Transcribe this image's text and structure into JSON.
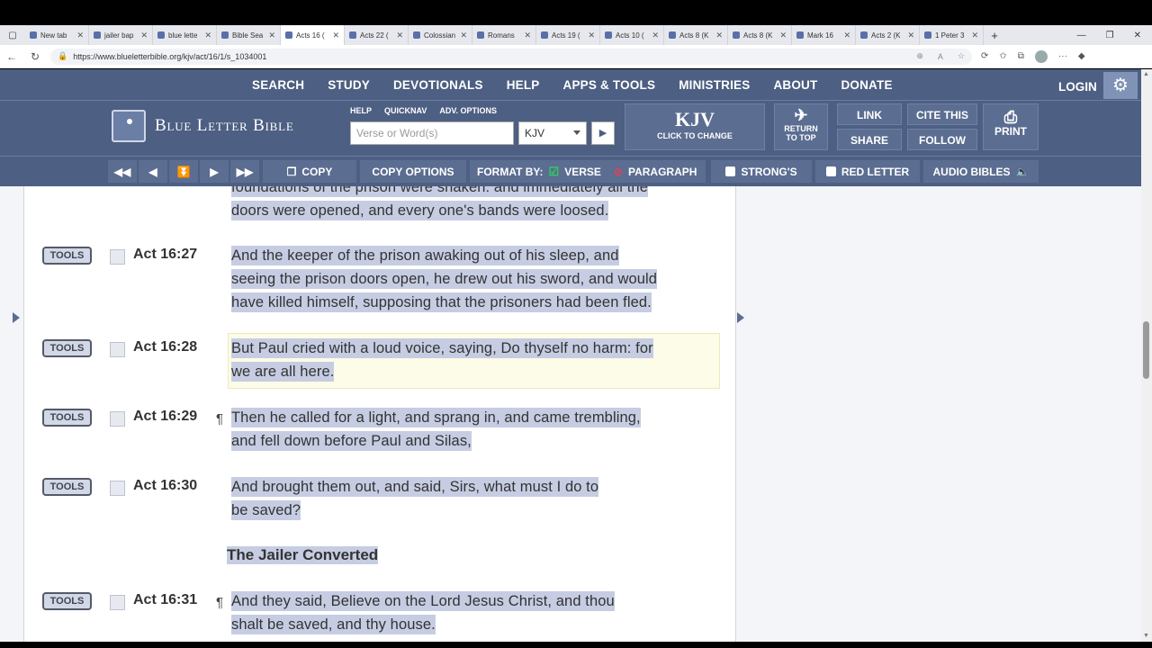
{
  "browser": {
    "tabs": [
      {
        "title": "New tab",
        "active": false
      },
      {
        "title": "jailer bap",
        "active": false
      },
      {
        "title": "blue lette",
        "active": false
      },
      {
        "title": "Bible Sea",
        "active": false
      },
      {
        "title": "Acts 16 (",
        "active": true
      },
      {
        "title": "Acts 22 (",
        "active": false
      },
      {
        "title": "Colossian",
        "active": false
      },
      {
        "title": "Romans",
        "active": false
      },
      {
        "title": "Acts 19 (",
        "active": false
      },
      {
        "title": "Acts 10 (",
        "active": false
      },
      {
        "title": "Acts 8 (K",
        "active": false
      },
      {
        "title": "Acts 8 (K",
        "active": false
      },
      {
        "title": "Mark 16",
        "active": false
      },
      {
        "title": "Acts 2 (K",
        "active": false
      },
      {
        "title": "1 Peter 3",
        "active": false
      }
    ],
    "url": "https://www.blueletterbible.org/kjv/act/16/1/s_1034001"
  },
  "nav": {
    "items": [
      "SEARCH",
      "STUDY",
      "DEVOTIONALS",
      "HELP",
      "APPS & TOOLS",
      "MINISTRIES",
      "ABOUT",
      "DONATE"
    ],
    "login": "LOGIN"
  },
  "header": {
    "logo_text": "Blue Letter Bible",
    "mini_links": [
      "HELP",
      "QUICKNAV",
      "ADV. OPTIONS"
    ],
    "search_placeholder": "Verse or Word(s)",
    "version": "KJV",
    "kjv_big": "KJV",
    "kjv_change": "CLICK TO CHANGE",
    "return_top_1": "RETURN",
    "return_top_2": "TO TOP",
    "link": "LINK",
    "cite": "CITE THIS",
    "share": "SHARE",
    "follow": "FOLLOW",
    "print": "PRINT"
  },
  "toolbar": {
    "copy": "COPY",
    "copy_options": "COPY OPTIONS",
    "format_by": "FORMAT BY:",
    "verse": "VERSE",
    "paragraph": "PARAGRAPH",
    "strongs": "STRONG'S",
    "red_letter": "RED LETTER",
    "audio": "AUDIO BIBLES"
  },
  "verses": {
    "partial_line1": "foundations of the prison were shaken: and immediately all the",
    "partial_line2": "doors were opened, and every one's bands were loosed.",
    "tools_label": "TOOLS",
    "v27_ref": "Act 16:27",
    "v27_l1": "And the keeper of the prison awaking out of his sleep, and",
    "v27_l2": "seeing the prison doors open, he drew out his sword, and would",
    "v27_l3": "have killed himself, supposing that the prisoners had been fled.",
    "v28_ref": "Act 16:28",
    "v28_l1": "But Paul cried with a loud voice, saying, Do thyself no harm: for",
    "v28_l2": "we are all here.",
    "v29_ref": "Act 16:29",
    "v29_l1": "Then he called for a light, and sprang in, and came trembling,",
    "v29_l2": "and fell down before Paul and Silas,",
    "v30_ref": "Act 16:30",
    "v30_l1": "And brought them out, and said, Sirs, what must I do to",
    "v30_l2": "be saved?",
    "heading": "The Jailer Converted",
    "v31_ref": "Act 16:31",
    "v31_l1": "And they said, Believe on the Lord Jesus Christ, and thou",
    "v31_l2": "shalt be saved, and thy house.",
    "pilcrow": "¶"
  }
}
